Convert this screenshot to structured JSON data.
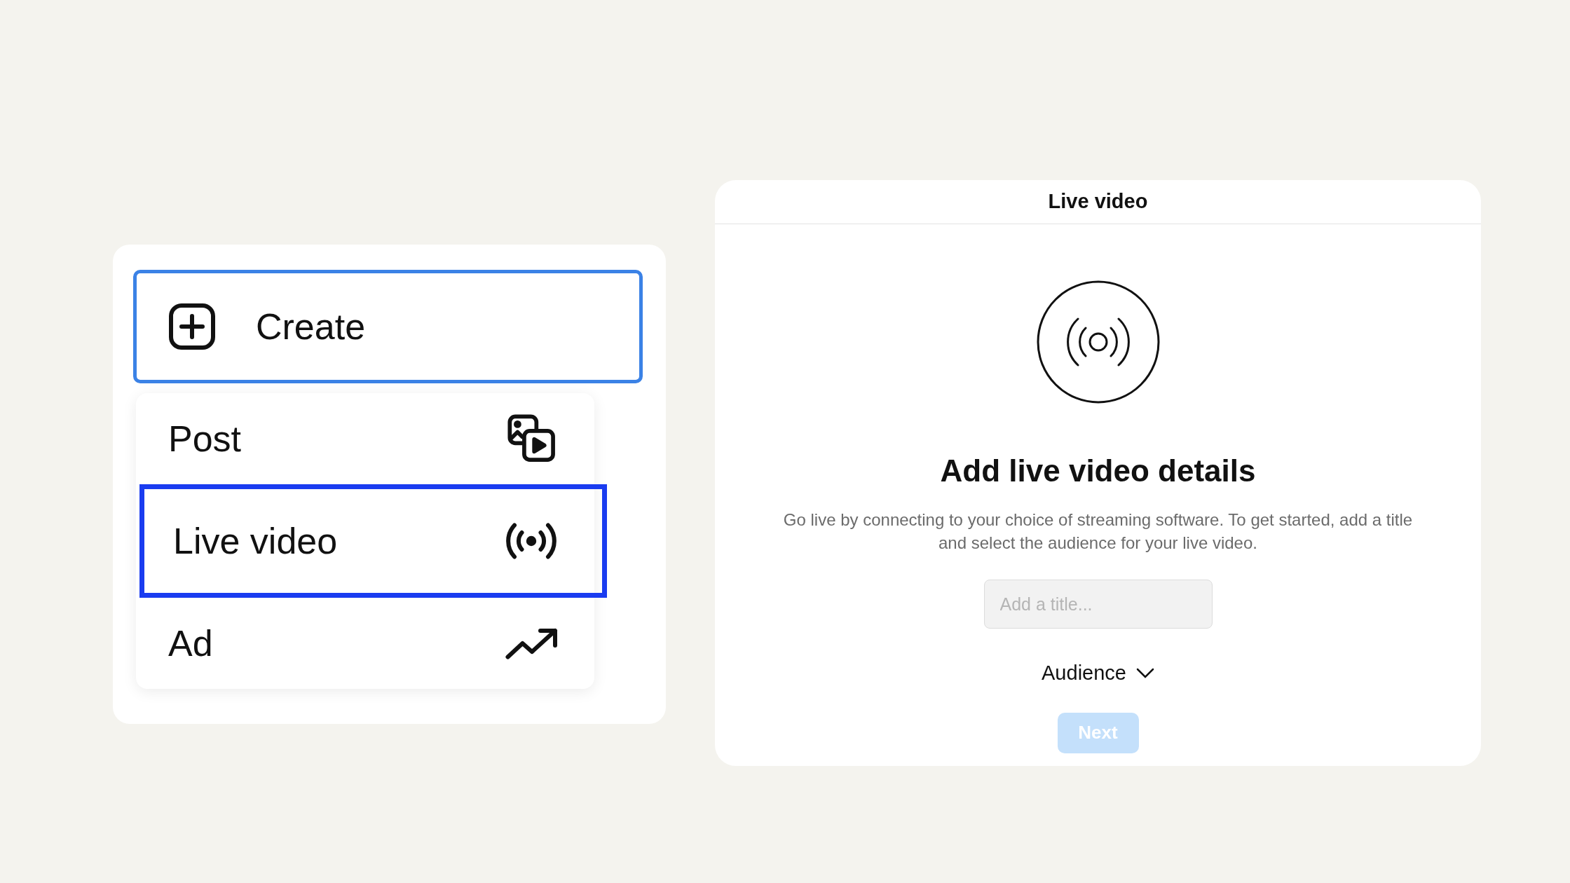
{
  "create_button": {
    "label": "Create",
    "selected": true
  },
  "create_menu": [
    {
      "label": "Post",
      "selected": false
    },
    {
      "label": "Live video",
      "selected": true
    },
    {
      "label": "Ad",
      "selected": false
    }
  ],
  "dialog": {
    "title": "Live video",
    "heading": "Add live video details",
    "description": "Go live by connecting to your choice of streaming software. To get started, add a title and select the audience for your live video.",
    "title_field": {
      "placeholder": "Add a title..."
    },
    "audience": "Audience",
    "next_button": {
      "label": "Next",
      "disabled": true
    }
  }
}
